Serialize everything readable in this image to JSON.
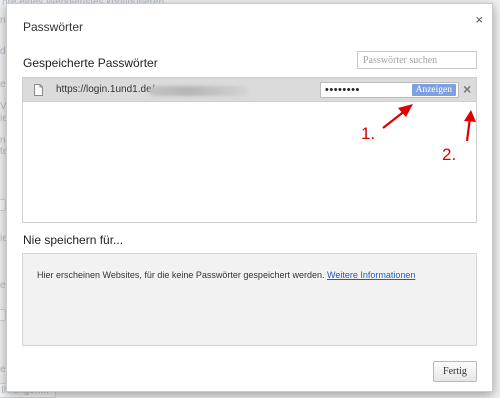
{
  "background": {
    "top_text": "hre eines Webdienstes konfigurieren",
    "left_fragments": [
      "nd",
      "d",
      "e",
      "V",
      "ie",
      "n",
      "d",
      "te",
      "el",
      "ie",
      "ert c",
      "en",
      "e S"
    ],
    "bottom_text": "Ihrungen..."
  },
  "dialog": {
    "title": "Passwörter",
    "close_label": "×",
    "saved_heading": "Gespeicherte Passwörter",
    "search_placeholder": "Passwörter suchen",
    "rows": [
      {
        "url": "https://login.1und1.de/",
        "password_mask": "••••••••",
        "show_label": "Anzeigen",
        "delete_label": "×"
      }
    ],
    "never_heading": "Nie speichern für...",
    "never_text": "Hier erscheinen Websites, für die keine Passwörter gespeichert werden.",
    "more_link": "Weitere Informationen",
    "done_label": "Fertig"
  },
  "annotations": {
    "label_1": "1.",
    "label_2": "2.",
    "color": "#dd0000"
  },
  "colors": {
    "show_button": "#7e9fe1",
    "link": "#1f5dbd",
    "row_highlight": "#dbdbdb"
  }
}
